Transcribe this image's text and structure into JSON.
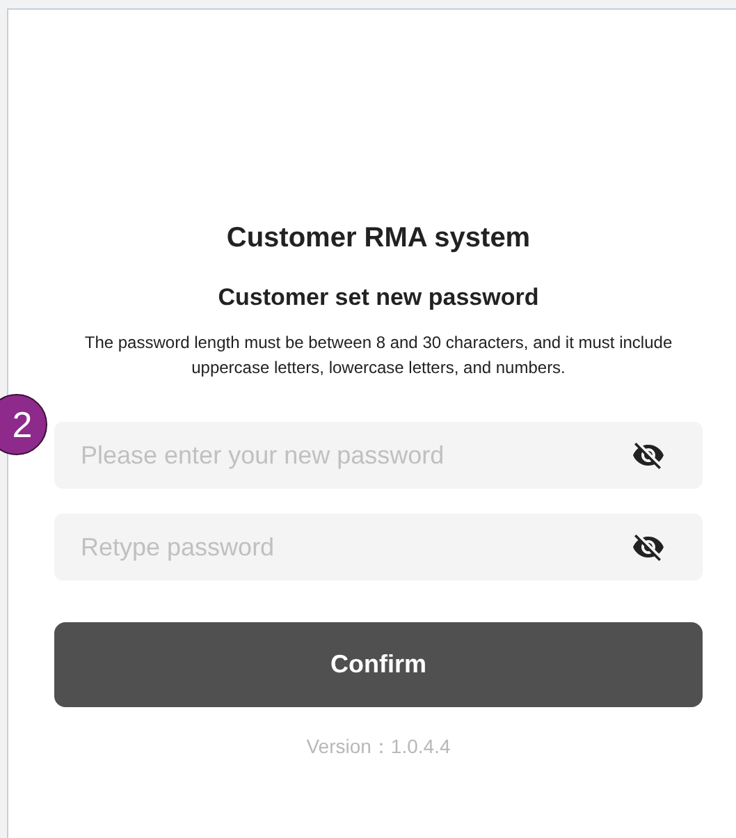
{
  "title": "Customer RMA system",
  "subtitle": "Customer set new password",
  "description": "The password length must be between 8 and 30 characters, and it must include uppercase letters, lowercase letters, and numbers.",
  "step_badge": "2",
  "fields": [
    {
      "placeholder": "Please enter your new password"
    },
    {
      "placeholder": "Retype password"
    }
  ],
  "confirm_button": "Confirm",
  "version": "Version：1.0.4.4"
}
